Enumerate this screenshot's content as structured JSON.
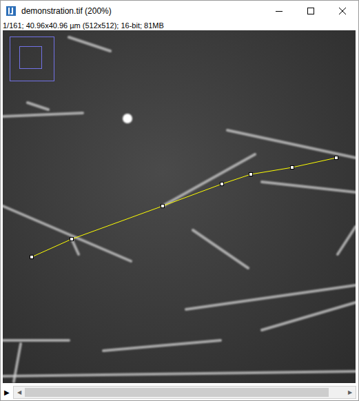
{
  "window": {
    "title": "demonstration.tif (200%)"
  },
  "info": "1/161; 40.96x40.96 µm (512x512); 16-bit; 81MB",
  "image": {
    "zoom_indicator": true
  },
  "roi": {
    "kind": "segmented-line",
    "color": "#ffff00",
    "selected": true
  },
  "scrollbar": {
    "play": "▶",
    "left": "◀",
    "right": "▶",
    "level": 0
  }
}
